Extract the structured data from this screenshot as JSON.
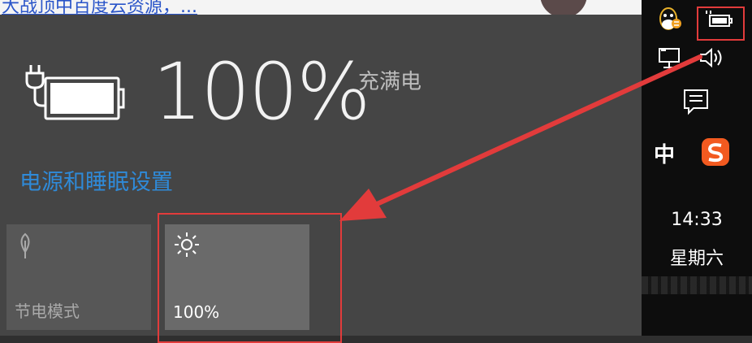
{
  "background_page": {
    "link_text": "大战顶中百度云资源，..."
  },
  "flyout": {
    "battery_percent": "100%",
    "battery_status": "充满电",
    "battery_level_fraction": 1.0,
    "settings_link": "电源和睡眠设置",
    "tiles": [
      {
        "label": "节电模式",
        "icon": "leaf-icon",
        "active": false
      },
      {
        "label": "100%",
        "icon": "brightness-icon",
        "active": true
      }
    ]
  },
  "tray": {
    "ime_label": "中",
    "time": "14:33",
    "weekday": "星期六",
    "icons": [
      "qq-icon",
      "battery-icon",
      "network-icon",
      "volume-icon",
      "action-center-icon",
      "sogou-icon"
    ]
  },
  "colors": {
    "flyout_bg": "#454545",
    "link": "#2f8ad8",
    "annotation": "#e23b3b",
    "taskbar": "#0d0d0d"
  }
}
